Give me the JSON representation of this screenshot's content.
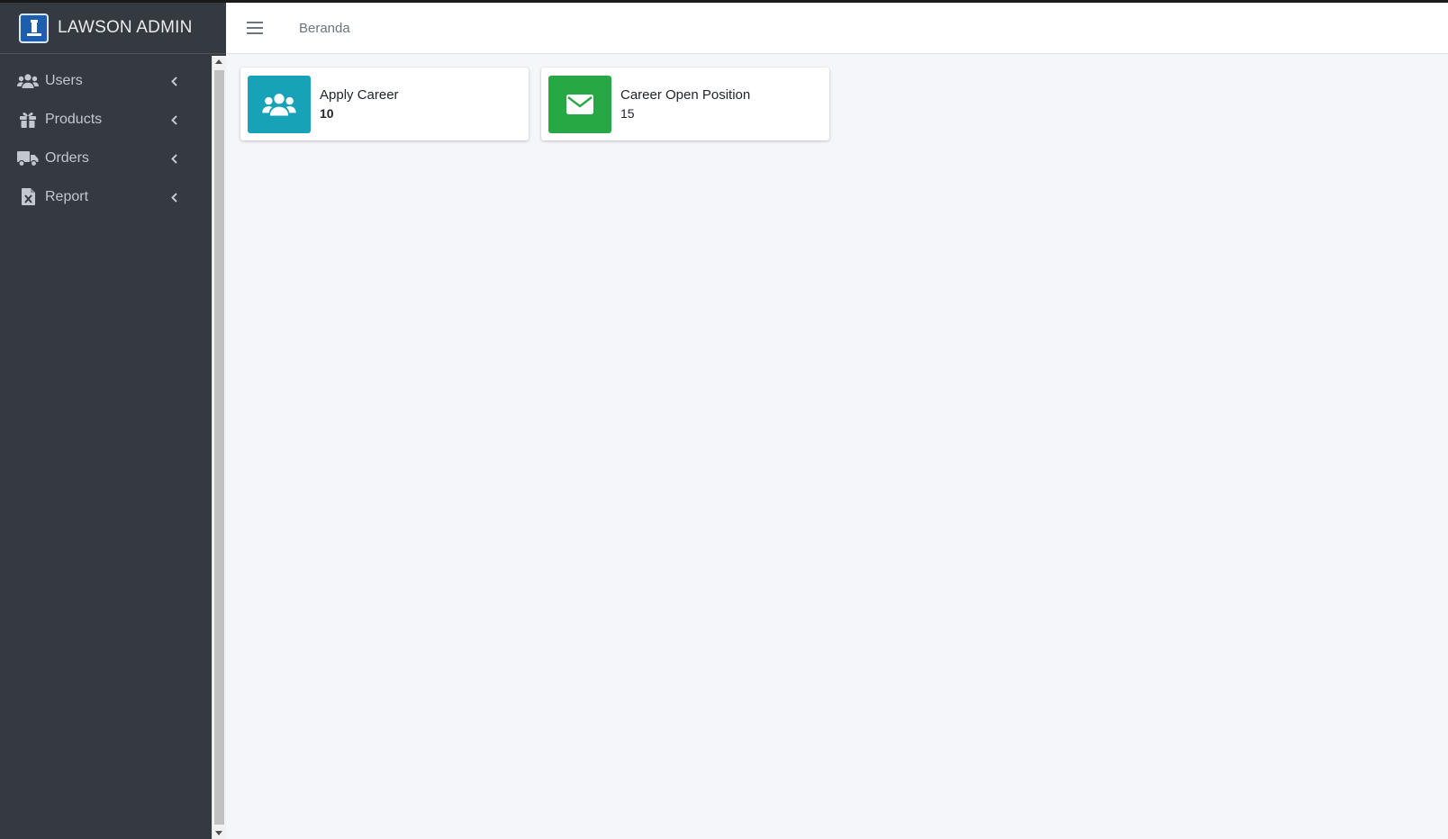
{
  "brand": {
    "text": "LAWSON ADMIN",
    "logo_icon": "lawson-station-logo"
  },
  "sidebar": {
    "items": [
      {
        "label": "Users",
        "icon": "users-icon"
      },
      {
        "label": "Products",
        "icon": "gift-icon"
      },
      {
        "label": "Orders",
        "icon": "truck-icon"
      },
      {
        "label": "Report",
        "icon": "excel-file-icon"
      }
    ]
  },
  "header": {
    "breadcrumb": "Beranda"
  },
  "cards": [
    {
      "title": "Apply Career",
      "value": "10",
      "icon": "users-icon",
      "color": "#17a2b8"
    },
    {
      "title": "Career Open Position",
      "value": "15",
      "icon": "envelope-icon",
      "color": "#28a745"
    }
  ],
  "colors": {
    "sidebar": "#343a40",
    "background": "#f4f6f9",
    "info": "#17a2b8",
    "success": "#28a745"
  }
}
